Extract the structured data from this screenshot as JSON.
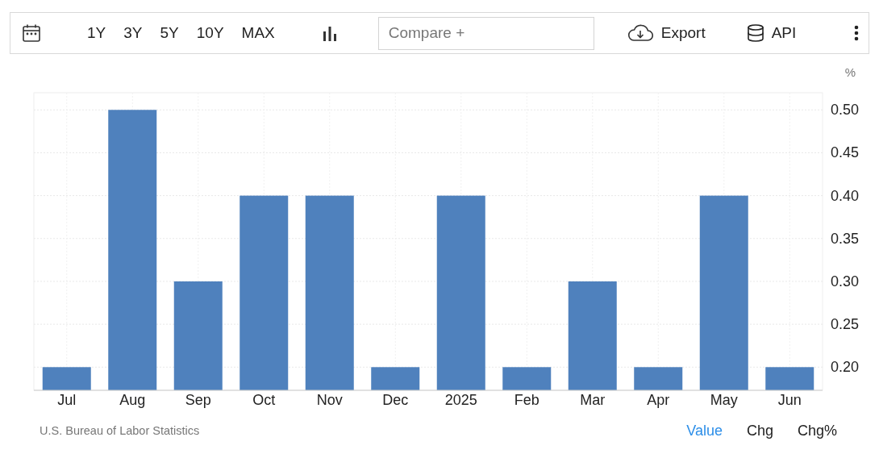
{
  "toolbar": {
    "ranges": [
      "1Y",
      "3Y",
      "5Y",
      "10Y",
      "MAX"
    ],
    "compare": {
      "placeholder": "Compare +"
    },
    "export": "Export",
    "api": "API"
  },
  "chart": {
    "unit": "%",
    "chart_data": {
      "type": "bar",
      "categories": [
        "Jul",
        "Aug",
        "Sep",
        "Oct",
        "Nov",
        "Dec",
        "2025",
        "Feb",
        "Mar",
        "Apr",
        "May",
        "Jun"
      ],
      "grid": true,
      "series": [
        {
          "color": "#4f81bd",
          "values": [
            0.2,
            0.5,
            0.3,
            0.4,
            0.4,
            0.2,
            0.4,
            0.2,
            0.3,
            0.2,
            0.4,
            0.2
          ]
        }
      ],
      "ylim": [
        0.173,
        0.52
      ],
      "yticks": [
        {
          "value": 0.2,
          "label": "0.20"
        },
        {
          "value": 0.25,
          "label": "0.25"
        },
        {
          "value": 0.3,
          "label": "0.30"
        },
        {
          "value": 0.35,
          "label": "0.35"
        },
        {
          "value": 0.4,
          "label": "0.40"
        },
        {
          "value": 0.45,
          "label": "0.45"
        },
        {
          "value": 0.5,
          "label": "0.50"
        }
      ]
    }
  },
  "footer": {
    "source": "U.S. Bureau of Labor Statistics",
    "modes": [
      {
        "label": "Value",
        "selected": true
      },
      {
        "label": "Chg",
        "selected": false
      },
      {
        "label": "Chg%",
        "selected": false
      }
    ]
  }
}
